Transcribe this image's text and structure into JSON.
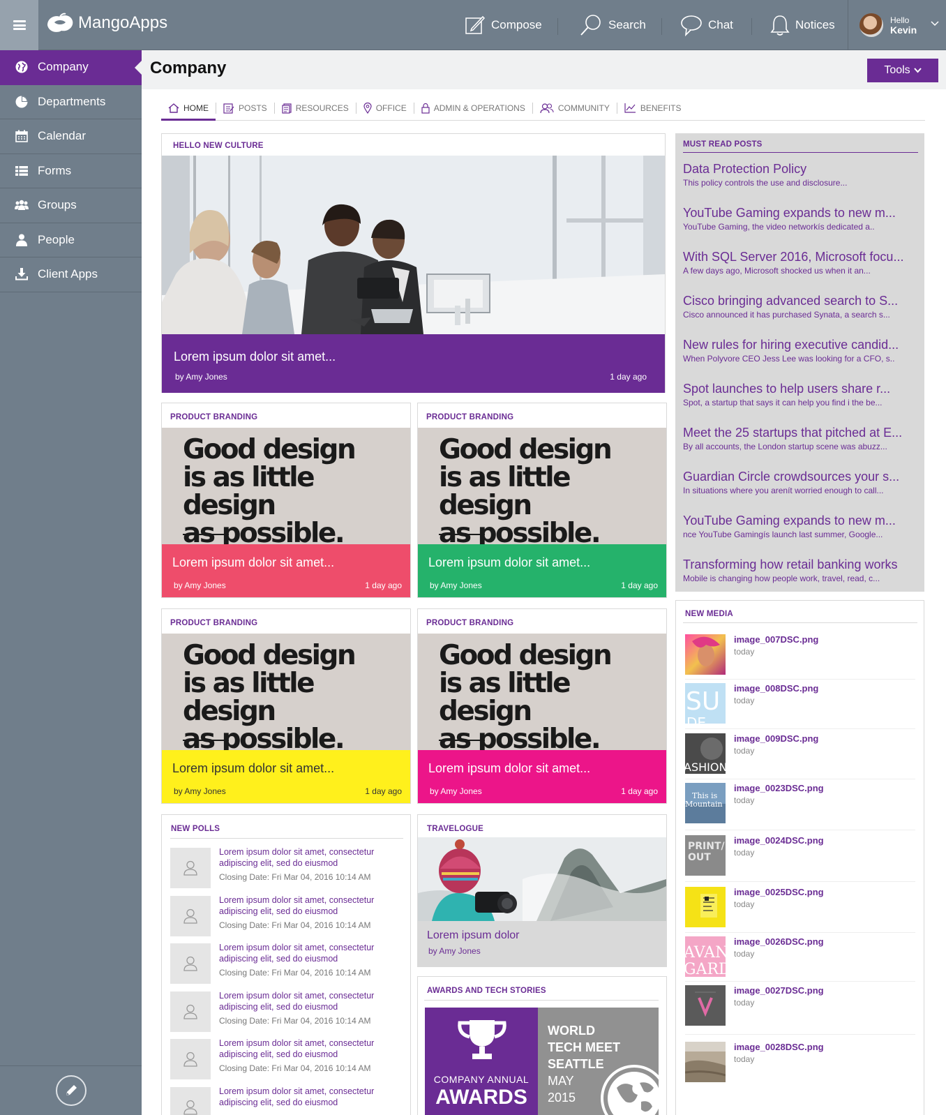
{
  "app": {
    "name": "MangoApps"
  },
  "topnav": {
    "compose": "Compose",
    "search": "Search",
    "chat": "Chat",
    "notices": "Notices",
    "user_hello": "Hello",
    "user_name": "Kevin"
  },
  "sidebar": {
    "items": [
      {
        "label": "Company",
        "icon": "globe-icon"
      },
      {
        "label": "Departments",
        "icon": "pie-chart-icon"
      },
      {
        "label": "Calendar",
        "icon": "calendar-icon"
      },
      {
        "label": "Forms",
        "icon": "list-icon"
      },
      {
        "label": "Groups",
        "icon": "group-icon"
      },
      {
        "label": "People",
        "icon": "person-icon"
      },
      {
        "label": "Client Apps",
        "icon": "download-icon"
      }
    ]
  },
  "page": {
    "title": "Company",
    "tools": "Tools"
  },
  "tabs": [
    "HOME",
    "POSTS",
    "RESOURCES",
    "OFFICE",
    "ADMIN & OPERATIONS",
    "COMMUNITY",
    "BENEFITS"
  ],
  "hero": {
    "heading": "HELLO NEW CULTURE",
    "caption": "Lorem ipsum dolor sit amet...",
    "author": "by Amy Jones",
    "time": "1 day ago"
  },
  "branding": [
    {
      "heading": "PRODUCT BRANDING",
      "quote1": "Good design",
      "quote2": "is as little design",
      "quote3": "as possible.",
      "caption": "Lorem ipsum dolor sit amet...",
      "author": "by Amy Jones",
      "time": "1 day ago",
      "color": "#ee4d6b"
    },
    {
      "heading": "PRODUCT BRANDING",
      "quote1": "Good design",
      "quote2": "is as little design",
      "quote3": "as possible.",
      "caption": "Lorem ipsum dolor sit amet...",
      "author": "by Amy Jones",
      "time": "1 day ago",
      "color": "#25b26b"
    },
    {
      "heading": "PRODUCT BRANDING",
      "quote1": "Good design",
      "quote2": "is as little design",
      "quote3": "as possible.",
      "caption": "Lorem ipsum dolor sit amet...",
      "author": "by Amy Jones",
      "time": "1 day ago",
      "color": "#fff01c"
    },
    {
      "heading": "PRODUCT BRANDING",
      "quote1": "Good design",
      "quote2": "is as little design",
      "quote3": "as possible.",
      "caption": "Lorem ipsum dolor sit amet...",
      "author": "by Amy Jones",
      "time": "1 day ago",
      "color": "#ec1589"
    }
  ],
  "polls": {
    "heading": "NEW POLLS",
    "items": [
      {
        "text": "Lorem ipsum dolor sit amet, consectetur adipiscing elit, sed do eiusmod",
        "date": "Closing Date: Fri Mar 04, 2016 10:14 AM"
      },
      {
        "text": "Lorem ipsum dolor sit amet, consectetur adipiscing elit, sed do eiusmod",
        "date": "Closing Date: Fri Mar 04, 2016 10:14 AM"
      },
      {
        "text": "Lorem ipsum dolor sit amet, consectetur adipiscing elit, sed do eiusmod",
        "date": "Closing Date: Fri Mar 04, 2016 10:14 AM"
      },
      {
        "text": "Lorem ipsum dolor sit amet, consectetur adipiscing elit, sed do eiusmod",
        "date": "Closing Date: Fri Mar 04, 2016 10:14 AM"
      },
      {
        "text": "Lorem ipsum dolor sit amet, consectetur adipiscing elit, sed do eiusmod",
        "date": "Closing Date: Fri Mar 04, 2016 10:14 AM"
      },
      {
        "text": "Lorem ipsum dolor sit amet, consectetur adipiscing elit, sed do eiusmod",
        "date": ""
      }
    ]
  },
  "travelogue": {
    "heading": "TRAVELOGUE",
    "caption": "Lorem ipsum dolor",
    "author": "by Amy Jones"
  },
  "awards": {
    "heading": "AWARDS AND TECH STORIES",
    "small": "COMPANY ANNUAL",
    "big": "AWARDS",
    "event1": "WORLD",
    "event2": "TECH MEET",
    "event3": "SEATTLE",
    "event4": "MAY",
    "event5": "2015"
  },
  "must_read": {
    "heading": "MUST READ POSTS",
    "items": [
      {
        "title": "Data Protection Policy",
        "sub": "This policy controls the use and disclosure..."
      },
      {
        "title": "YouTube Gaming expands to new m...",
        "sub": "YouTube Gaming, the video networkís dedicated a.."
      },
      {
        "title": "With SQL Server 2016, Microsoft focu...",
        "sub": "A few days ago, Microsoft shocked us when it an..."
      },
      {
        "title": "Cisco bringing advanced search to S...",
        "sub": "Cisco announced it has purchased Synata, a search s..."
      },
      {
        "title": "New rules for hiring executive candid...",
        "sub": "When Polyvore CEO Jess Lee was looking for a CFO, s.."
      },
      {
        "title": "Spot launches to help users share r...",
        "sub": "Spot, a startup that says it can help you find i the be..."
      },
      {
        "title": "Meet the 25 startups that pitched at E...",
        "sub": "By all accounts, the London startup scene was abuzz..."
      },
      {
        "title": "Guardian Circle crowdsources your s...",
        "sub": "In situations where you arenít worried enough to call..."
      },
      {
        "title": "YouTube Gaming expands to new m...",
        "sub": "nce YouTube Gamingís launch last summer, Google..."
      },
      {
        "title": "Transforming how retail banking works",
        "sub": "Mobile is changing how people work, travel, read, c..."
      }
    ]
  },
  "new_media": {
    "heading": "NEW MEDIA",
    "items": [
      {
        "name": "image_007DSC.png",
        "date": "today"
      },
      {
        "name": "image_008DSC.png",
        "date": "today",
        "thumb_text": "SU"
      },
      {
        "name": "image_009DSC.png",
        "date": "today",
        "thumb_text": "ASHION"
      },
      {
        "name": "image_0023DSC.png",
        "date": "today",
        "thumb_text": "This is Mountain"
      },
      {
        "name": "image_0024DSC.png",
        "date": "today",
        "thumb_text": "PRINT/ OUT"
      },
      {
        "name": "image_0025DSC.png",
        "date": "today"
      },
      {
        "name": "image_0026DSC.png",
        "date": "today",
        "thumb_text": "AVANT GARDE"
      },
      {
        "name": "image_0027DSC.png",
        "date": "today"
      },
      {
        "name": "image_0028DSC.png",
        "date": "today"
      }
    ]
  },
  "colors": {
    "accent": "#6a2c94",
    "chrome": "#707e8b"
  }
}
